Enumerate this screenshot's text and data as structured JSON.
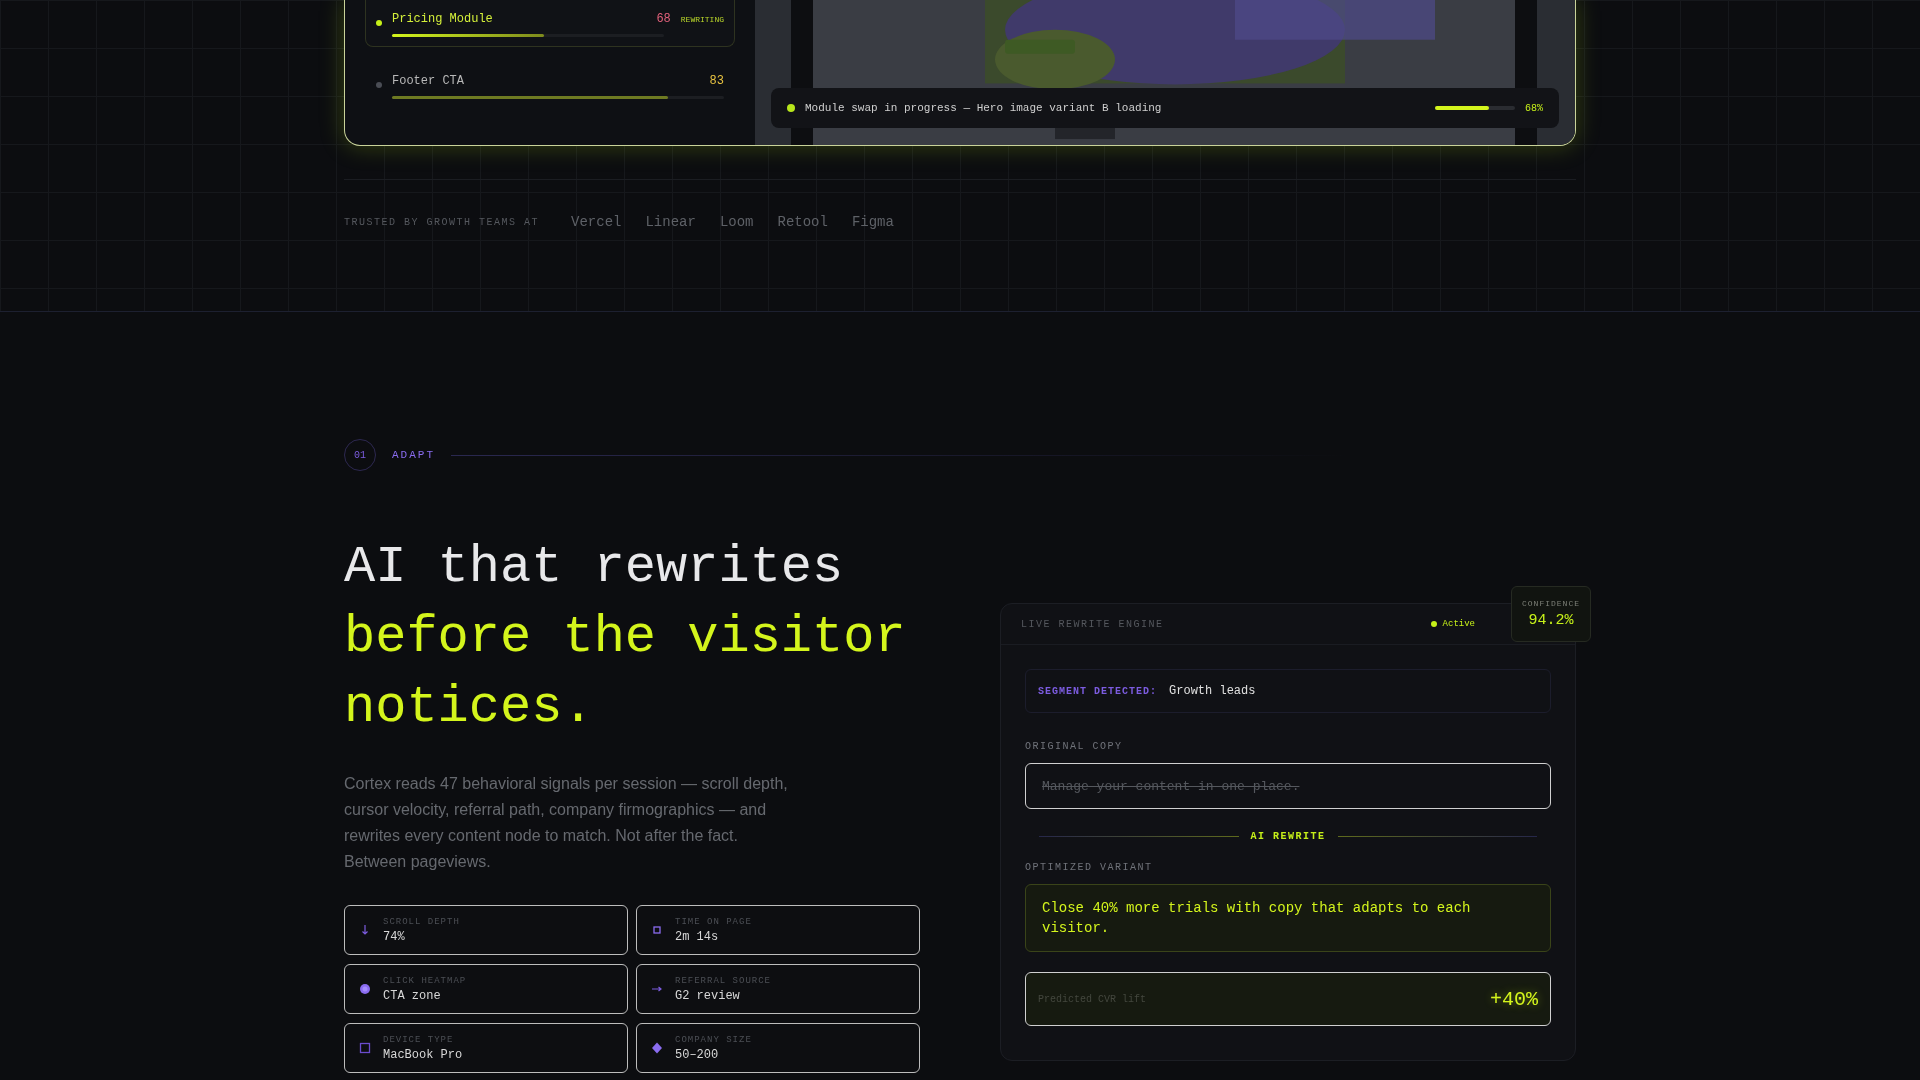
{
  "modules": [
    {
      "name": "Pricing Module",
      "score": "68",
      "color": "#e0607a",
      "level": 0.56,
      "selected": true,
      "badge": "REWRITING"
    },
    {
      "name": "Footer CTA",
      "score": "83",
      "color": "#e8c341",
      "level": 0.83,
      "selected": false
    }
  ],
  "swap_status": {
    "text": "Module swap in progress — Hero image variant B loading",
    "level": 0.68,
    "reading": "68%"
  },
  "trusted": {
    "label": "TRUSTED BY GROWTH TEAMS AT",
    "logos": [
      "Vercel",
      "Linear",
      "Loom",
      "Retool",
      "Figma"
    ]
  },
  "section": {
    "number": "01",
    "label": "ADAPT"
  },
  "headline": {
    "line1": "AI that rewrites",
    "line2": "before the visitor notices."
  },
  "body": "Cortex reads 47 behavioral signals per session — scroll depth, cursor velocity, referral path, company firmographics — and rewrites every content node to match. Not after the fact. Between pageviews.",
  "signals": [
    {
      "label": "SCROLL DEPTH",
      "value": "74%"
    },
    {
      "label": "TIME ON PAGE",
      "value": "2m 14s"
    },
    {
      "label": "CLICK HEATMAP",
      "value": "CTA zone"
    },
    {
      "label": "REFERRAL SOURCE",
      "value": "G2 review"
    },
    {
      "label": "DEVICE TYPE",
      "value": "MacBook Pro"
    },
    {
      "label": "COMPANY SIZE",
      "value": "50–200"
    }
  ],
  "engine": {
    "title": "LIVE REWRITE ENGINE",
    "status": "Active",
    "active": true,
    "confidence": {
      "label": "CONFIDENCE",
      "value": "94.2%"
    },
    "segment": {
      "label": "SEGMENT DETECTED:",
      "value": "Growth leads"
    },
    "original_label": "ORIGINAL COPY",
    "original": "Manage your content in one place.",
    "divider": "AI REWRITE",
    "optimized_label": "OPTIMIZED VARIANT",
    "optimized": "Close 40% more trials with copy that adapts to each visitor.",
    "lift": {
      "label": "Predicted CVR lift",
      "value": "+40%"
    }
  }
}
